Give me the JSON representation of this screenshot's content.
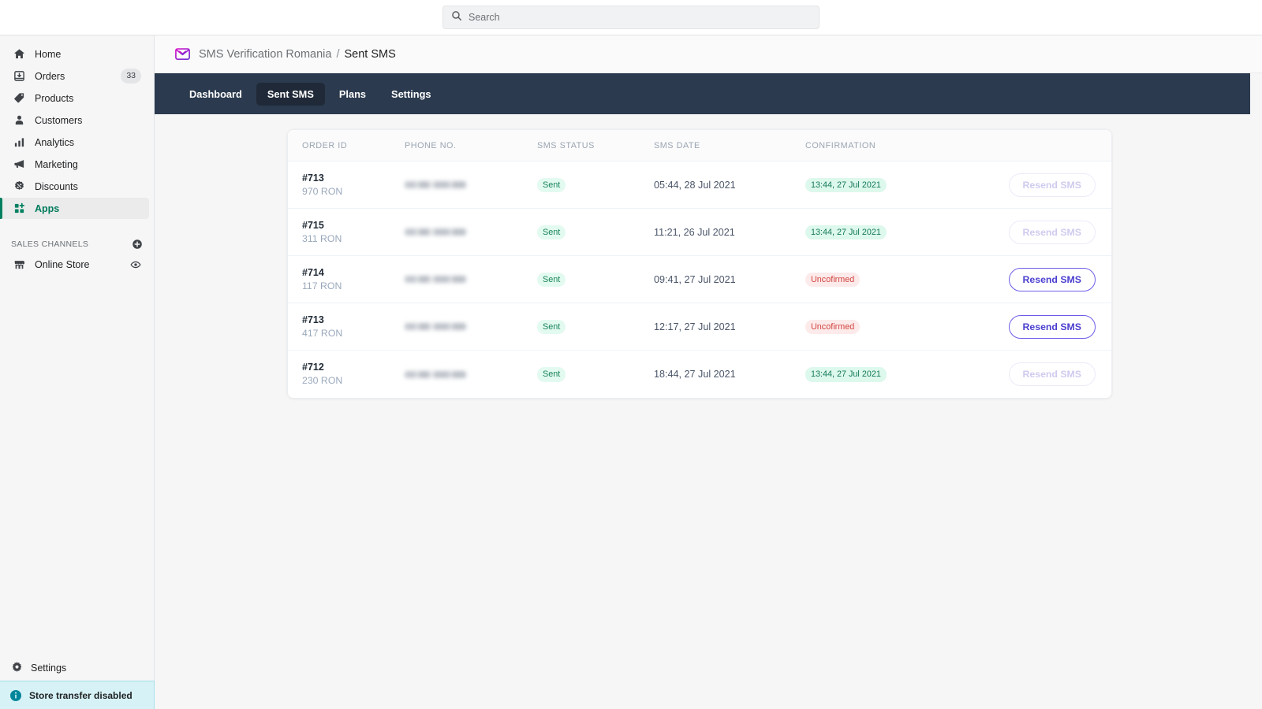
{
  "search": {
    "placeholder": "Search",
    "value": "",
    "icon": "search-icon"
  },
  "sidebar": {
    "items": [
      {
        "label": "Home",
        "icon": "home-icon",
        "badge": null,
        "active": false
      },
      {
        "label": "Orders",
        "icon": "orders-inbox-icon",
        "badge": "33",
        "active": false
      },
      {
        "label": "Products",
        "icon": "tag-icon",
        "badge": null,
        "active": false
      },
      {
        "label": "Customers",
        "icon": "person-icon",
        "badge": null,
        "active": false
      },
      {
        "label": "Analytics",
        "icon": "bar-chart-icon",
        "badge": null,
        "active": false
      },
      {
        "label": "Marketing",
        "icon": "megaphone-icon",
        "badge": null,
        "active": false
      },
      {
        "label": "Discounts",
        "icon": "discount-badge-icon",
        "badge": null,
        "active": false
      },
      {
        "label": "Apps",
        "icon": "apps-grid-icon",
        "badge": null,
        "active": true
      }
    ],
    "sales_channels": {
      "title": "SALES CHANNELS",
      "add_icon": "plus-circle-icon",
      "items": [
        {
          "label": "Online Store",
          "icon": "storefront-icon",
          "trailing_icon": "eye-icon"
        }
      ]
    },
    "settings": {
      "label": "Settings",
      "icon": "gear-icon"
    },
    "transfer_banner": {
      "label": "Store transfer disabled",
      "icon": "info-circle-icon"
    },
    "accent_color": "#008060"
  },
  "breadcrumb": {
    "app_icon": "envelope-check-icon",
    "app_name": "SMS Verification Romania",
    "separator": "/",
    "current": "Sent SMS"
  },
  "app_nav": {
    "background": "#2b3a4e",
    "tabs": [
      {
        "label": "Dashboard",
        "active": false
      },
      {
        "label": "Sent SMS",
        "active": true
      },
      {
        "label": "Plans",
        "active": false
      },
      {
        "label": "Settings",
        "active": false
      }
    ]
  },
  "table": {
    "columns": [
      "ORDER ID",
      "PHONE NO.",
      "SMS STATUS",
      "SMS DATE",
      "CONFIRMATION",
      ""
    ],
    "rows": [
      {
        "order_id": "#713",
        "amount": "970 RON",
        "phone": "",
        "sms_status": "Sent",
        "sms_date": "05:44, 28 Jul 2021",
        "confirmation": "13:44, 27 Jul 2021",
        "confirmed": true,
        "action_label": "Resend SMS",
        "action_enabled": false
      },
      {
        "order_id": "#715",
        "amount": "311 RON",
        "phone": "",
        "sms_status": "Sent",
        "sms_date": "11:21, 26 Jul 2021",
        "confirmation": "13:44, 27 Jul 2021",
        "confirmed": true,
        "action_label": "Resend SMS",
        "action_enabled": false
      },
      {
        "order_id": "#714",
        "amount": "117 RON",
        "phone": "",
        "sms_status": "Sent",
        "sms_date": "09:41, 27 Jul 2021",
        "confirmation": "Uncofirmed",
        "confirmed": false,
        "action_label": "Resend SMS",
        "action_enabled": true
      },
      {
        "order_id": "#713",
        "amount": "417 RON",
        "phone": "",
        "sms_status": "Sent",
        "sms_date": "12:17, 27 Jul 2021",
        "confirmation": "Uncofirmed",
        "confirmed": false,
        "action_label": "Resend SMS",
        "action_enabled": true
      },
      {
        "order_id": "#712",
        "amount": "230 RON",
        "phone": "",
        "sms_status": "Sent",
        "sms_date": "18:44, 27 Jul 2021",
        "confirmation": "13:44, 27 Jul 2021",
        "confirmed": true,
        "action_label": "Resend SMS",
        "action_enabled": false
      }
    ]
  },
  "colors": {
    "sent_badge": "#17835a",
    "confirmed_badge": "#14795a",
    "unconfirmed_badge": "#d0453f",
    "resend_enabled": "#4b3fcf",
    "nav_dark": "#2b3a4e"
  }
}
